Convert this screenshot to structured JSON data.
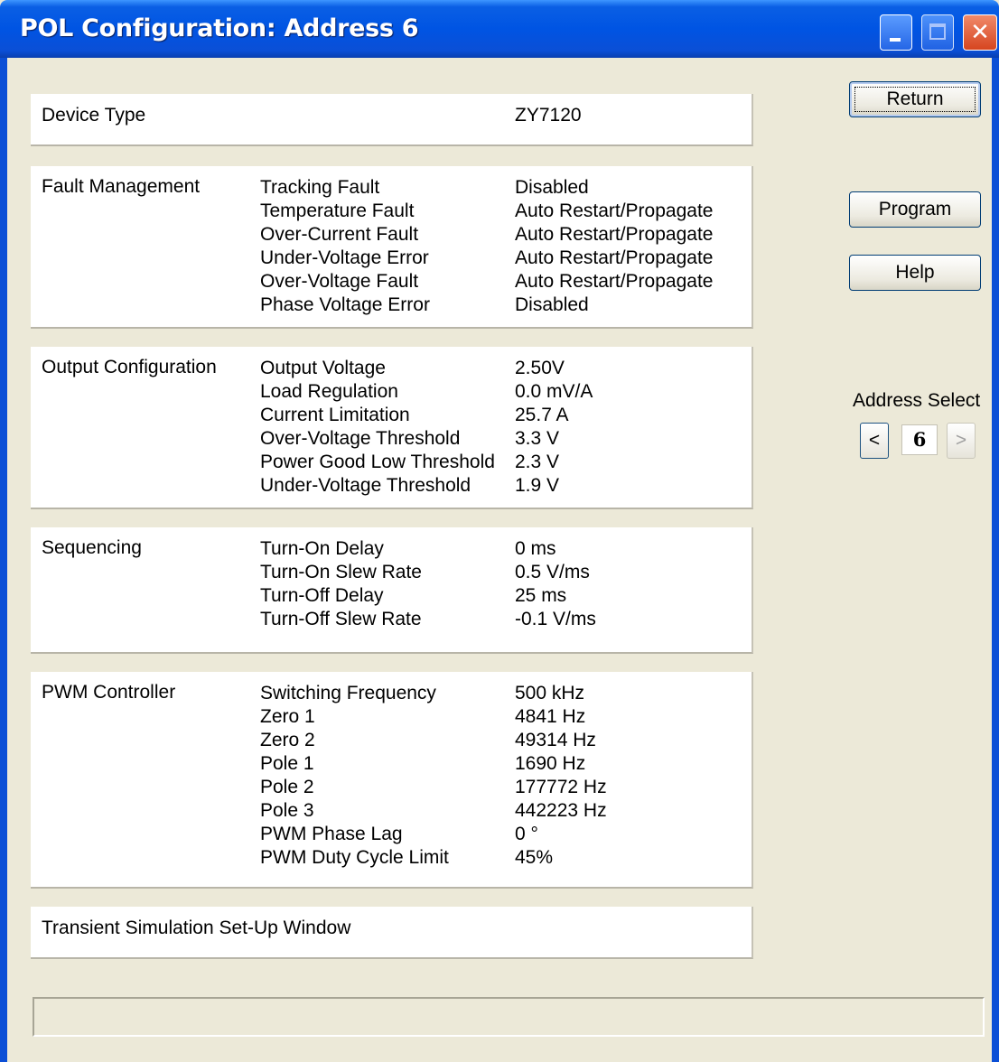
{
  "window": {
    "title": "POL Configuration: Address 6"
  },
  "buttons": {
    "return_label": "Return",
    "program_label": "Program",
    "help_label": "Help"
  },
  "address_select": {
    "label": "Address Select",
    "prev_label": "<",
    "value": "6",
    "next_label": ">"
  },
  "device_type": {
    "label": "Device Type",
    "value": "ZY7120"
  },
  "fault_management": {
    "label": "Fault Management",
    "items": [
      {
        "name": "Tracking Fault",
        "value": "Disabled"
      },
      {
        "name": "Temperature Fault",
        "value": "Auto Restart/Propagate"
      },
      {
        "name": "Over-Current Fault",
        "value": "Auto Restart/Propagate"
      },
      {
        "name": "Under-Voltage Error",
        "value": "Auto Restart/Propagate"
      },
      {
        "name": "Over-Voltage Fault",
        "value": "Auto Restart/Propagate"
      },
      {
        "name": "Phase Voltage Error",
        "value": "Disabled"
      }
    ]
  },
  "output_configuration": {
    "label": "Output Configuration",
    "items": [
      {
        "name": "Output Voltage",
        "value": "2.50V"
      },
      {
        "name": "Load Regulation",
        "value": "0.0 mV/A"
      },
      {
        "name": "Current Limitation",
        "value": "25.7 A"
      },
      {
        "name": "Over-Voltage Threshold",
        "value": "3.3 V"
      },
      {
        "name": "Power Good Low Threshold",
        "value": "2.3 V"
      },
      {
        "name": "Under-Voltage Threshold",
        "value": "1.9 V"
      }
    ]
  },
  "sequencing": {
    "label": "Sequencing",
    "items": [
      {
        "name": "Turn-On Delay",
        "value": "0 ms"
      },
      {
        "name": "Turn-On Slew Rate",
        "value": "0.5 V/ms"
      },
      {
        "name": "Turn-Off Delay",
        "value": "25 ms"
      },
      {
        "name": "Turn-Off Slew Rate",
        "value": "-0.1 V/ms"
      }
    ]
  },
  "pwm_controller": {
    "label": "PWM Controller",
    "items": [
      {
        "name": "Switching Frequency",
        "value": "500 kHz"
      },
      {
        "name": "Zero 1",
        "value": "4841 Hz"
      },
      {
        "name": "Zero 2",
        "value": "49314 Hz"
      },
      {
        "name": "Pole 1",
        "value": "1690 Hz"
      },
      {
        "name": "Pole 2",
        "value": "177772 Hz"
      },
      {
        "name": "Pole 3",
        "value": "442223 Hz"
      },
      {
        "name": "PWM Phase Lag",
        "value": "0 °"
      },
      {
        "name": "PWM Duty Cycle Limit",
        "value": "45%"
      }
    ]
  },
  "transient": {
    "label": "Transient Simulation Set-Up Window"
  },
  "status_bar": {
    "text": ""
  },
  "colors": {
    "titlebar": "#0054e3",
    "window_bg": "#ece9d8",
    "panel_bg": "#ffffff",
    "close_button": "#d6451f"
  },
  "icons": [
    "minimize-icon",
    "maximize-icon",
    "close-icon"
  ]
}
